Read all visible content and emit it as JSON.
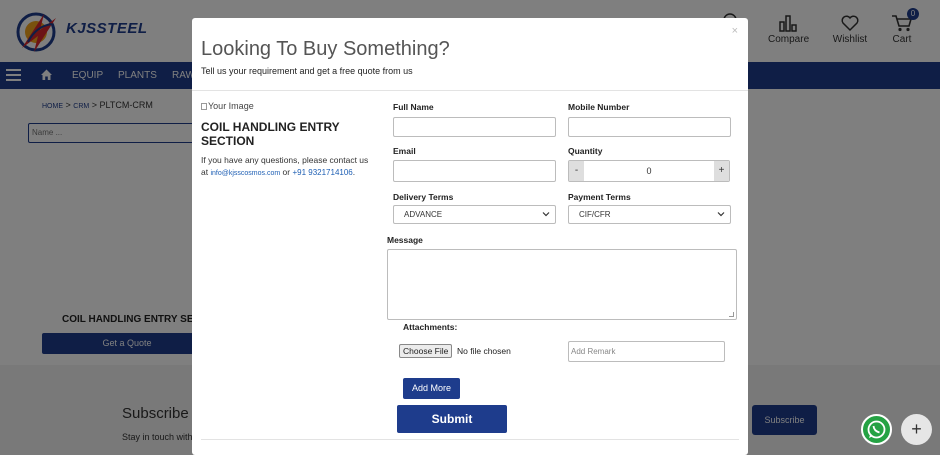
{
  "header": {
    "logo_text": "KJSSTEEL",
    "compare_label": "Compare",
    "wishlist_label": "Wishlist",
    "cart_label": "Cart",
    "cart_count": "0"
  },
  "nav": {
    "items": [
      "EQUIP",
      "PLANTS",
      "RAW"
    ]
  },
  "breadcrumb": {
    "home": "HOME",
    "sep1": " > ",
    "crm": "CRM",
    "sep2": " > ",
    "current": "PLTCM-CRM"
  },
  "background": {
    "name_placeholder": "Name ...",
    "product_title": "COIL HANDLING ENTRY SEC",
    "get_quote_label": "Get a Quote",
    "subscribe_title": "Subscribe",
    "subscribe_sub": "Stay in touch with",
    "subscribe_button": "Subscribe"
  },
  "modal": {
    "close_label": "×",
    "title": "Looking To Buy Something?",
    "subtitle": "Tell us your requirement and get a free quote from us",
    "image_alt": "Your Image",
    "product_name": "COIL HANDLING ENTRY SECTION",
    "desc_before": "If you have any questions, please contact us at ",
    "contact_email": "info@kjsscosmos.com",
    "desc_or": " or ",
    "contact_phone": "+91 9321714106",
    "desc_after": ".",
    "fields": {
      "full_name_label": "Full Name",
      "full_name_value": "",
      "mobile_label": "Mobile Number",
      "mobile_value": "",
      "email_label": "Email",
      "email_value": "",
      "quantity_label": "Quantity",
      "quantity_minus": "-",
      "quantity_value": "0",
      "quantity_plus": "+",
      "delivery_label": "Delivery Terms",
      "delivery_value": "ADVANCE",
      "payment_label": "Payment Terms",
      "payment_value": "CIF/CFR",
      "message_label": "Message",
      "message_value": "",
      "attachments_label": "Attachments:",
      "choose_file_label": "Choose File",
      "no_file_label": "No file chosen",
      "remark_placeholder": "Add Remark"
    },
    "add_more_label": "Add More",
    "submit_label": "Submit"
  },
  "colors": {
    "brand_blue": "#1e3c8c",
    "whatsapp_green": "#25a244",
    "link_blue": "#1e5fb4"
  },
  "icons": {
    "logo": "kjs-logo-icon",
    "compare": "bar-chart-icon",
    "wishlist": "heart-icon",
    "cart": "cart-icon",
    "home": "home-icon",
    "menu": "hamburger-icon",
    "whatsapp": "whatsapp-icon",
    "plus": "plus-icon"
  }
}
